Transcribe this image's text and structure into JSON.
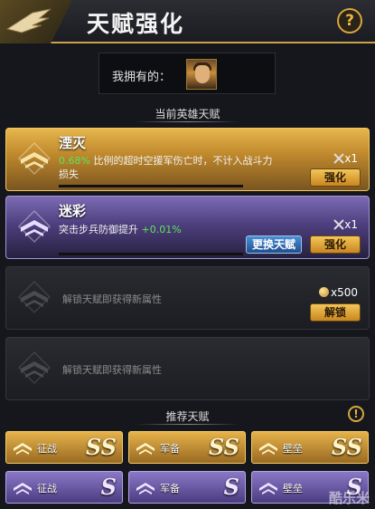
{
  "header": {
    "title": "天赋强化",
    "help_label": "?"
  },
  "owned": {
    "label": "我拥有的："
  },
  "current_section_title": "当前英雄天赋",
  "talents": [
    {
      "name": "湮灭",
      "desc_value": "0.68%",
      "desc_text": "比例的超时空援军伤亡时，不计入战斗力损失",
      "cost": "x1",
      "button": "强化"
    },
    {
      "name": "迷彩",
      "desc_text": "突击步兵防御提升",
      "desc_value": "+0.01%",
      "cost": "x1",
      "replace_button": "更换天赋",
      "button": "强化"
    },
    {
      "desc_text": "解锁天赋即获得新属性",
      "cost": "x500",
      "button": "解锁"
    },
    {
      "desc_text": "解锁天赋即获得新属性"
    }
  ],
  "recommend_section_title": "推荐天赋",
  "recommend_warning": "!",
  "recommended": [
    {
      "name": "征战",
      "grade": "SS"
    },
    {
      "name": "军备",
      "grade": "SS"
    },
    {
      "name": "壁垒",
      "grade": "SS"
    },
    {
      "name": "征战",
      "grade": "S"
    },
    {
      "name": "军备",
      "grade": "S"
    },
    {
      "name": "壁垒",
      "grade": "S"
    }
  ],
  "watermark": "酷乐米",
  "colors": {
    "gold": "#e7b64e",
    "purple": "#7d6bb4",
    "green": "#5ee45e",
    "accent": "#d9a63d"
  }
}
